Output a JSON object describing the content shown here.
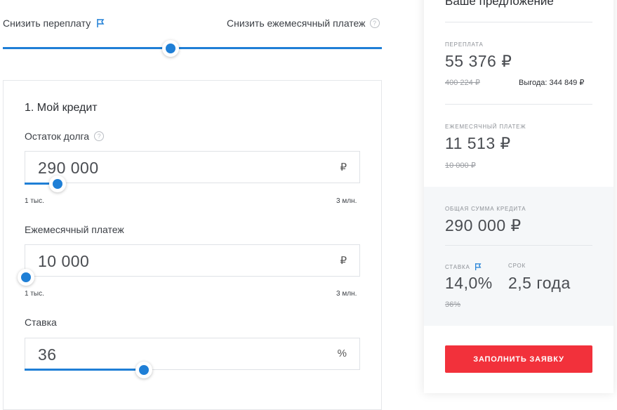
{
  "mode": {
    "left_label": "Снизить переплату",
    "right_label": "Снизить ежемесячный платеж",
    "help_glyph": "?"
  },
  "credit": {
    "title": "1. Мой кредит",
    "debt": {
      "label": "Остаток долга",
      "help_glyph": "?",
      "value": "290 000",
      "unit": "₽",
      "min_label": "1 тыс.",
      "max_label": "3 млн."
    },
    "monthly": {
      "label": "Ежемесячный платеж",
      "value": "10 000",
      "unit": "₽",
      "min_label": "1 тыс.",
      "max_label": "3 млн."
    },
    "rate": {
      "label": "Ставка",
      "value": "36",
      "unit": "%"
    }
  },
  "offer": {
    "title": "Ваше предложение",
    "overpay": {
      "label": "Переплата",
      "value": "55 376 ₽",
      "old_value": "400 224 ₽",
      "benefit": "Выгода: 344 849 ₽"
    },
    "monthly": {
      "label": "Ежемесячный платеж",
      "value": "11 513 ₽",
      "old_value": "10 000 ₽"
    },
    "total": {
      "label": "Общая сумма кредита",
      "value": "290 000 ₽"
    },
    "rate": {
      "label": "Ставка",
      "value": "14,0%",
      "old_value": "36%"
    },
    "term": {
      "label": "Срок",
      "value": "2,5 года"
    },
    "apply_label": "ЗАПОЛНИТЬ ЗАЯВКУ"
  },
  "colors": {
    "accent": "#1f7fd6",
    "button": "#f2313b"
  },
  "icons": [
    "flag-icon",
    "help-icon"
  ]
}
